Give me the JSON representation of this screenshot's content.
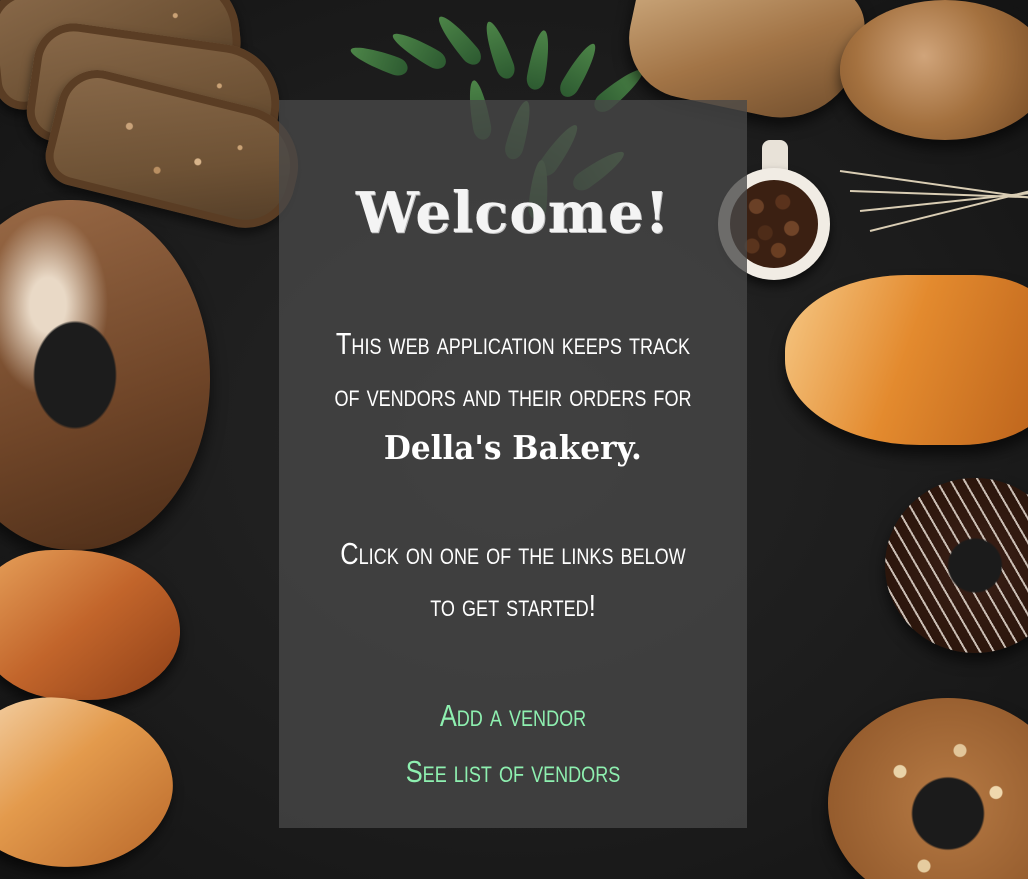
{
  "heading": "Welcome!",
  "intro": {
    "line1": "This web application keeps track",
    "line2": "of vendors and their orders for",
    "bakery_name": "Della's Bakery."
  },
  "instruction": {
    "line1": "Click on one of the links below",
    "line2": "to get started!"
  },
  "links": [
    {
      "label": "Add a vendor"
    },
    {
      "label": "See list of vendors"
    }
  ],
  "colors": {
    "link": "#8ef0b0",
    "panel": "#484848",
    "text": "#ffffff"
  }
}
